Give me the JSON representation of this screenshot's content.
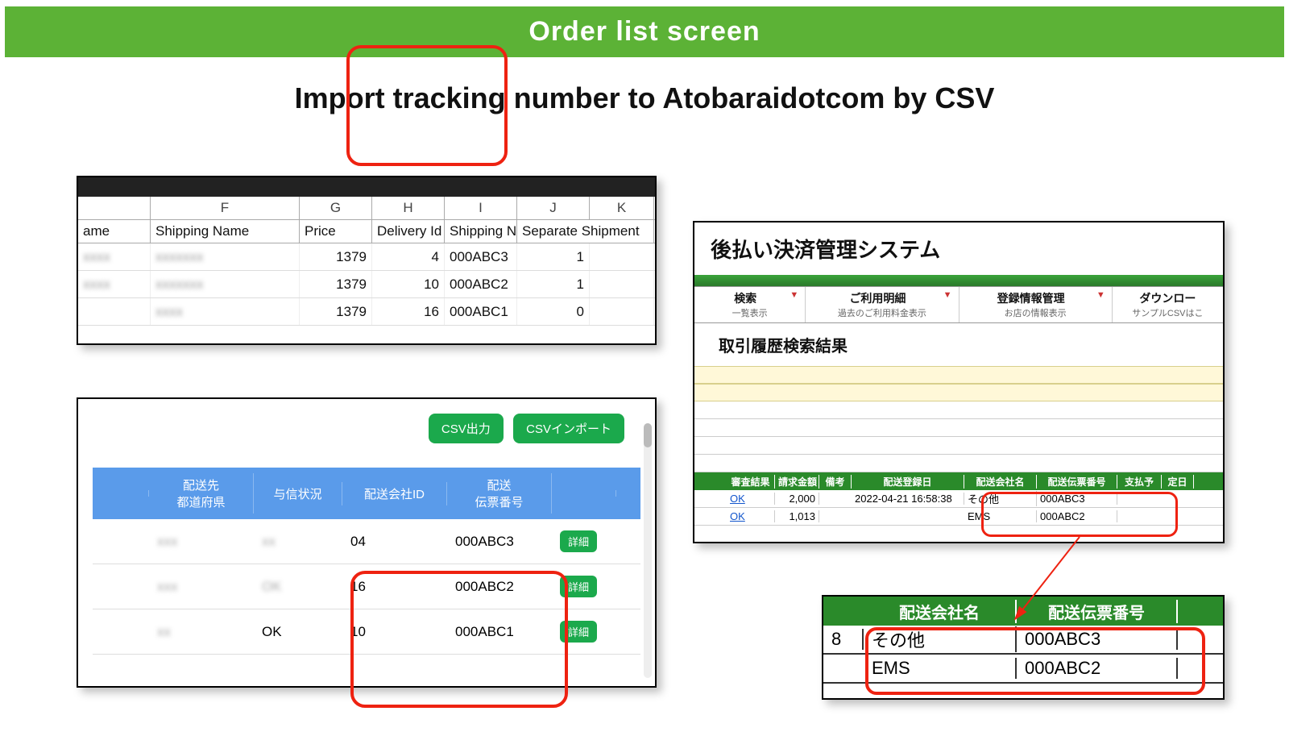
{
  "title_bar": "Order list screen",
  "subtitle": "Import tracking number to Atobaraidotcom by CSV",
  "spreadsheet": {
    "cols": {
      "F": "F",
      "G": "G",
      "H": "H",
      "I": "I",
      "J": "J",
      "K": "K"
    },
    "labels": {
      "ame": "ame",
      "shipping_name": "Shipping Name",
      "price": "Price",
      "delivery_id": "Delivery Id",
      "shipping_n": "Shipping N",
      "separate_shipment": "Separate Shipment"
    },
    "rows": [
      {
        "price": "1379",
        "delivery_id": "4",
        "shipping_n": "000ABC3",
        "sep": "1"
      },
      {
        "price": "1379",
        "delivery_id": "10",
        "shipping_n": "000ABC2",
        "sep": "1"
      },
      {
        "price": "1379",
        "delivery_id": "16",
        "shipping_n": "000ABC1",
        "sep": "0"
      }
    ]
  },
  "app_table": {
    "btn_export": "CSV出力",
    "btn_import": "CSVインポート",
    "headers": {
      "pref": "配送先\n都道府県",
      "credit": "与信状況",
      "carrier_id": "配送会社ID",
      "slip": "配送\n伝票番号"
    },
    "detail": "詳細",
    "rows": [
      {
        "credit": "",
        "carrier_id": "04",
        "slip": "000ABC3"
      },
      {
        "credit": "OK",
        "carrier_id": "16",
        "slip": "000ABC2"
      },
      {
        "credit": "OK",
        "carrier_id": "10",
        "slip": "000ABC1"
      }
    ]
  },
  "admin": {
    "system_title": "後払い決済管理システム",
    "nav": {
      "search": {
        "t": "検索",
        "s": "一覧表示"
      },
      "usage": {
        "t": "ご利用明細",
        "s": "過去のご利用料金表示"
      },
      "reg": {
        "t": "登録情報管理",
        "s": "お店の情報表示"
      },
      "dl": {
        "t": "ダウンロー",
        "s": "サンプルCSVはこ"
      }
    },
    "result_title": "取引履歴検索結果",
    "thead": {
      "c2": "審査結果",
      "c3": "請求金額",
      "c4": "備考",
      "c5": "配送登録日",
      "c6": "配送会社名",
      "c7": "配送伝票番号",
      "c8": "支払予",
      "c9": "定日"
    },
    "rows": [
      {
        "ok": "OK",
        "amount": "2,000",
        "date": "2022-04-21 16:58:38",
        "carrier": "その他",
        "slip": "000ABC3"
      },
      {
        "ok": "OK",
        "amount": "1,013",
        "date": "",
        "carrier": "EMS",
        "slip": "000ABC2"
      }
    ]
  },
  "zoom": {
    "h1": "配送会社名",
    "h2": "配送伝票番号",
    "row0_c0": "8",
    "rows": [
      {
        "carrier": "その他",
        "slip": "000ABC3"
      },
      {
        "carrier": "EMS",
        "slip": "000ABC2"
      }
    ]
  }
}
